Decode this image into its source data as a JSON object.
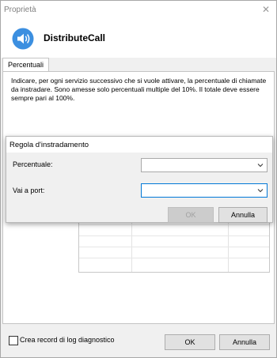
{
  "window": {
    "title": "Proprietà",
    "close_glyph": "✕"
  },
  "header": {
    "icon": "speaker-icon",
    "name": "DistributeCall"
  },
  "tabs": [
    {
      "label": "Percentuali"
    }
  ],
  "description": "Indicare, per ogni servizio successivo che si vuole attivare, la percentuale di chiamate da instradare. Sono amesse solo percentuali multiple del 10%. Il totale deve essere sempre pari al 100%.",
  "dialog": {
    "title": "Regola d'instradamento",
    "percent_label": "Percentuale:",
    "percent_value": "",
    "port_label": "Vai a port:",
    "port_value": "",
    "ok_label": "OK",
    "cancel_label": "Annulla"
  },
  "footer": {
    "log_label": "Crea record di log diagnostico",
    "log_checked": false,
    "ok_label": "OK",
    "cancel_label": "Annulla"
  },
  "colors": {
    "accent": "#0078d7",
    "icon_blue": "#3c8fe0"
  }
}
